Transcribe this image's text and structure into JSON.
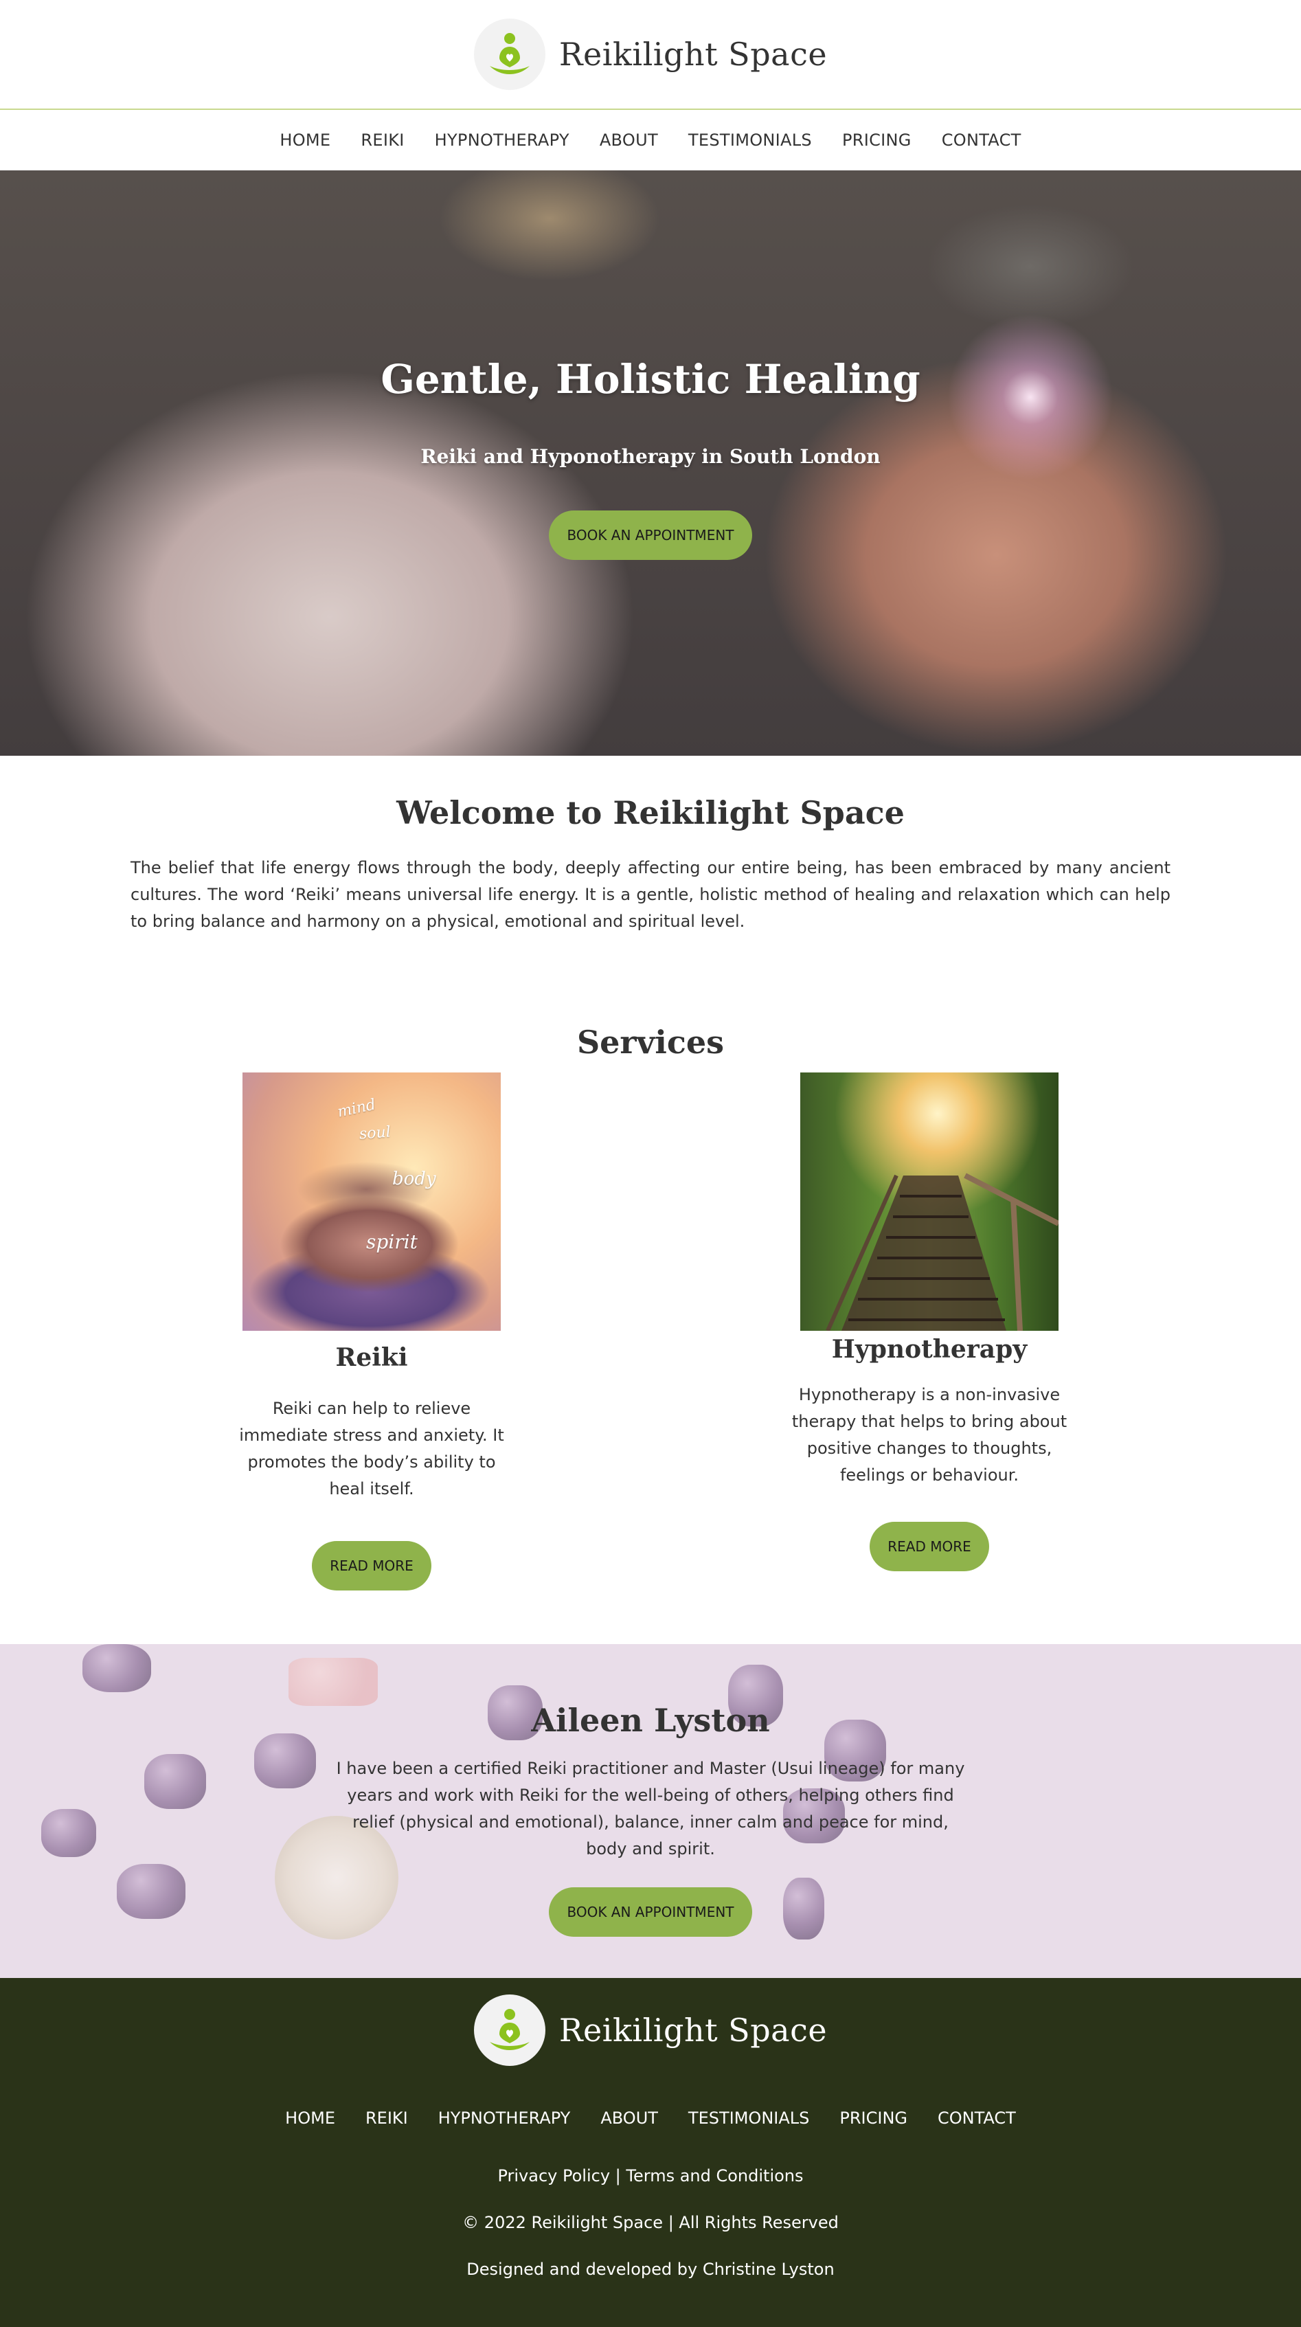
{
  "brand": {
    "name": "Reikilight Space",
    "logo_icon": "meditating-figure-icon",
    "accent": "#8fb34b"
  },
  "nav": {
    "items": [
      "HOME",
      "REIKI",
      "HYPNOTHERAPY",
      "ABOUT",
      "TESTIMONIALS",
      "PRICING",
      "CONTACT"
    ]
  },
  "hero": {
    "title": "Gentle, Holistic Healing",
    "subtitle": "Reiki and Hyponotherapy in South London",
    "button": "BOOK AN APPOINTMENT"
  },
  "welcome": {
    "title": "Welcome to Reikilight Space",
    "text": "The belief that life energy flows through the body, deeply affecting our entire being, has been embraced by many ancient cultures. The word ‘Reiki’ means universal life energy. It is a gentle, holistic method of healing and relaxation which can help to bring balance and harmony on a physical, emotional and spiritual level."
  },
  "services": {
    "title": "Services",
    "items": [
      {
        "title": "Reiki",
        "text": "Reiki can help to relieve immediate stress and anxiety. It promotes the body’s ability to heal itself.",
        "button": "READ MORE",
        "image_words": [
          "mind",
          "soul",
          "body",
          "spirit"
        ]
      },
      {
        "title": "Hypnotherapy",
        "text": "Hypnotherapy is a non-invasive therapy that helps to bring about positive changes to thoughts, feelings or behaviour.",
        "button": "READ MORE"
      }
    ]
  },
  "about": {
    "title": "Aileen Lyston",
    "text": "I have been a certified Reiki practitioner and Master (Usui lineage) for many years and work with Reiki for the well-being of others, helping others find relief (physical and emotional), balance, inner calm and peace for mind, body and spirit.",
    "button": "BOOK AN APPOINTMENT"
  },
  "footer": {
    "brand": "Reikilight Space",
    "nav": [
      "HOME",
      "REIKI",
      "HYPNOTHERAPY",
      "ABOUT",
      "TESTIMONIALS",
      "PRICING",
      "CONTACT"
    ],
    "privacy": "Privacy Policy",
    "separator": "|",
    "terms": "Terms and Conditions",
    "copyright": "© 2022 Reikilight Space | All Rights Reserved",
    "credit": "Designed and developed by Christine Lyston"
  }
}
